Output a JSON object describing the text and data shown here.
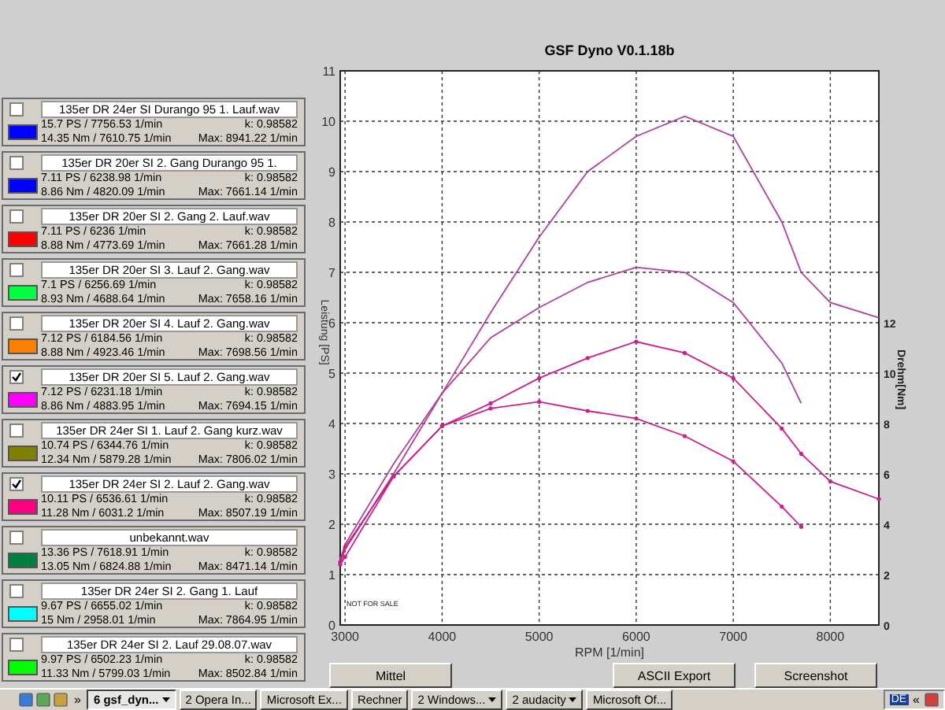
{
  "runs": [
    {
      "file": "135er DR 24er SI Durango 95 1. Lauf.wav",
      "checked": false,
      "color": "#0000ff",
      "power": "15.7 PS / 7756.53 1/min",
      "k": "k: 0.98582",
      "torque": "14.35 Nm / 7610.75 1/min",
      "max": "Max: 8941.22 1/min"
    },
    {
      "file": "135er DR 20er SI 2. Gang Durango 95 1.",
      "checked": false,
      "color": "#0000ff",
      "power": "7.11 PS / 6238.98 1/min",
      "k": "k: 0.98582",
      "torque": "8.86 Nm / 4820.09 1/min",
      "max": "Max: 7661.14 1/min"
    },
    {
      "file": "135er DR 20er SI 2. Gang 2. Lauf.wav",
      "checked": false,
      "color": "#ff0000",
      "power": "7.11 PS / 6236 1/min",
      "k": "k: 0.98582",
      "torque": "8.88 Nm / 4773.69 1/min",
      "max": "Max: 7661.28 1/min"
    },
    {
      "file": "135er DR 20er SI 3. Lauf 2. Gang.wav",
      "checked": false,
      "color": "#00ff40",
      "power": "7.1 PS / 6256.69 1/min",
      "k": "k: 0.98582",
      "torque": "8.93 Nm / 4688.64 1/min",
      "max": "Max: 7658.16 1/min"
    },
    {
      "file": "135er DR 20er SI 4. Lauf 2. Gang.wav",
      "checked": false,
      "color": "#ff8000",
      "power": "7.12 PS / 6184.56 1/min",
      "k": "k: 0.98582",
      "torque": "8.88 Nm / 4923.46 1/min",
      "max": "Max: 7698.56 1/min"
    },
    {
      "file": "135er DR 20er SI 5. Lauf 2. Gang.wav",
      "checked": true,
      "color": "#ff00ff",
      "power": "7.12 PS / 6231.18 1/min",
      "k": "k: 0.98582",
      "torque": "8.86 Nm / 4883.95 1/min",
      "max": "Max: 7694.15 1/min"
    },
    {
      "file": "135er DR 24er SI 1. Lauf 2. Gang kurz.wav",
      "checked": false,
      "color": "#808000",
      "power": "10.74 PS / 6344.76 1/min",
      "k": "k: 0.98582",
      "torque": "12.34 Nm / 5879.28 1/min",
      "max": "Max: 7806.02 1/min"
    },
    {
      "file": "135er DR 24er SI 2. Lauf 2. Gang.wav",
      "checked": true,
      "color": "#ff0080",
      "power": "10.11 PS / 6536.61 1/min",
      "k": "k: 0.98582",
      "torque": "11.28 Nm / 6031.2 1/min",
      "max": "Max: 8507.19 1/min"
    },
    {
      "file": "unbekannt.wav",
      "checked": false,
      "color": "#008040",
      "power": "13.36 PS / 7618.91 1/min",
      "k": "k: 0.98582",
      "torque": "13.05 Nm / 6824.88 1/min",
      "max": "Max: 8471.14 1/min"
    },
    {
      "file": "135er DR 24er SI 2. Gang 1. Lauf",
      "checked": false,
      "color": "#00ffff",
      "power": "9.67 PS / 6655.02 1/min",
      "k": "k: 0.98582",
      "torque": "15 Nm / 2958.01 1/min",
      "max": "Max: 7864.95 1/min"
    },
    {
      "file": "135er DR 24er SI 2. Lauf 29.08.07.wav",
      "checked": false,
      "color": "#00ff00",
      "power": "9.97 PS / 6502.23 1/min",
      "k": "k: 0.98582",
      "torque": "11.33 Nm / 5799.03 1/min",
      "max": "Max: 8502.84 1/min"
    }
  ],
  "chart": {
    "note": "NOT FOR SALE",
    "chart_data": {
      "type": "line",
      "title": "GSF Dyno V0.1.18b",
      "xlabel": "RPM [1/min]",
      "ylabel": "Leistung [PS]",
      "y2label": "Drehm[Nm]",
      "x": [
        2950,
        3000,
        3500,
        4000,
        4500,
        5000,
        5500,
        6000,
        6500,
        7000,
        7500,
        7700,
        8000,
        8500
      ],
      "series": [
        {
          "color": "#b0409a",
          "values": [
            1.2,
            1.5,
            3.0,
            4.6,
            6.2,
            7.7,
            9.0,
            9.7,
            10.1,
            9.7,
            8.0,
            7.0,
            6.4,
            6.1
          ]
        },
        {
          "color": "#b0409a",
          "values": [
            1.3,
            1.6,
            3.2,
            4.6,
            5.7,
            6.3,
            6.8,
            7.1,
            7.0,
            6.4,
            5.2,
            4.4,
            null,
            null
          ]
        },
        {
          "color": "#c8208c",
          "axis": "y2",
          "values": [
            2.5,
            3.1,
            5.9,
            7.9,
            8.8,
            9.8,
            10.6,
            11.25,
            10.8,
            9.8,
            7.8,
            6.8,
            5.7,
            5.0
          ]
        },
        {
          "color": "#c8208c",
          "axis": "y2",
          "values": [
            2.4,
            2.7,
            5.9,
            7.9,
            8.6,
            8.86,
            8.5,
            8.2,
            7.5,
            6.5,
            4.7,
            3.9,
            null,
            null
          ]
        }
      ],
      "xlim": [
        2950,
        8500
      ],
      "ylim": [
        0,
        11
      ],
      "y2lim": [
        0,
        22
      ],
      "grid": true,
      "xticks": [
        3000,
        4000,
        5000,
        6000,
        7000,
        8000
      ],
      "yticks": [
        0,
        1,
        2,
        3,
        4,
        5,
        6,
        7,
        8,
        9,
        10,
        11
      ],
      "y2ticks": [
        0,
        2,
        4,
        6,
        8,
        10,
        12
      ]
    }
  },
  "buttons": [
    "Mittel",
    "ASCII Export",
    "Screenshot"
  ],
  "taskbar": {
    "quick_launch": "»",
    "tasks": [
      {
        "label": "6 gsf_dyn...",
        "active": true,
        "grouped": true
      },
      {
        "label": "2 Opera In...",
        "active": false,
        "grouped": false
      },
      {
        "label": "Microsoft Ex...",
        "active": false,
        "grouped": false
      },
      {
        "label": "Rechner",
        "active": false,
        "grouped": false
      },
      {
        "label": "2 Windows...",
        "active": false,
        "grouped": true
      },
      {
        "label": "2 audacity",
        "active": false,
        "grouped": true
      },
      {
        "label": "Microsoft Of...",
        "active": false,
        "grouped": false
      }
    ],
    "language": "DE",
    "tray_toggle": "«"
  }
}
